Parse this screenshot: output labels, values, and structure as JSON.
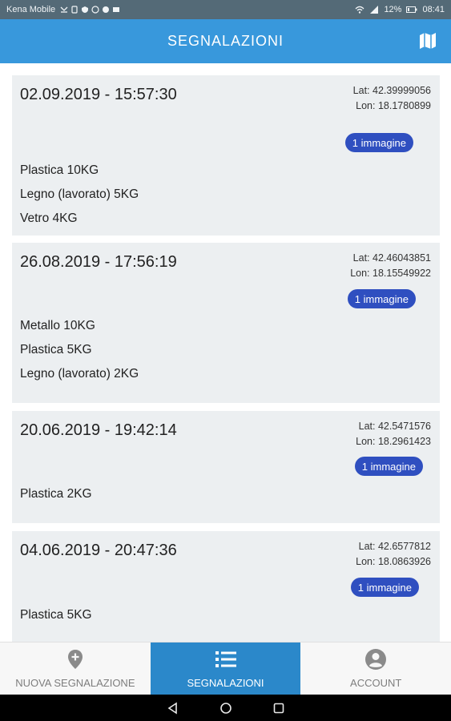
{
  "status_bar": {
    "carrier": "Kena Mobile",
    "battery": "12%",
    "time": "08:41"
  },
  "app_bar": {
    "title": "SEGNALAZIONI",
    "map_icon": "map-icon"
  },
  "reports": [
    {
      "date": "02.09.2019 - 15:57:30",
      "lat": "Lat: 42.39999056",
      "lon": "Lon: 18.1780899",
      "images": "1 immagine",
      "items": [
        "Plastica 10KG",
        "Legno (lavorato) 5KG",
        "Vetro 4KG"
      ]
    },
    {
      "date": "26.08.2019 - 17:56:19",
      "lat": "Lat: 42.46043851",
      "lon": "Lon: 18.15549922",
      "images": "1 immagine",
      "items": [
        "Metallo 10KG",
        "Plastica 5KG",
        "Legno (lavorato) 2KG"
      ]
    },
    {
      "date": "20.06.2019 - 19:42:14",
      "lat": "Lat: 42.5471576",
      "lon": "Lon: 18.2961423",
      "images": "1 immagine",
      "items": [
        "Plastica 2KG"
      ]
    },
    {
      "date": "04.06.2019 - 20:47:36",
      "lat": "Lat: 42.6577812",
      "lon": "Lon: 18.0863926",
      "images": "1 immagine",
      "items": [
        "Plastica 5KG"
      ]
    }
  ],
  "bottom_nav": [
    {
      "label": "NUOVA SEGNALAZIONE",
      "icon": "add-location-icon",
      "active": false
    },
    {
      "label": "SEGNALAZIONI",
      "icon": "list-icon",
      "active": true
    },
    {
      "label": "ACCOUNT",
      "icon": "account-icon",
      "active": false
    }
  ],
  "colors": {
    "app_bar": "#3898dc",
    "badge": "#2f4fc0",
    "active_tab": "#2b88ca",
    "card": "#eceff1"
  }
}
